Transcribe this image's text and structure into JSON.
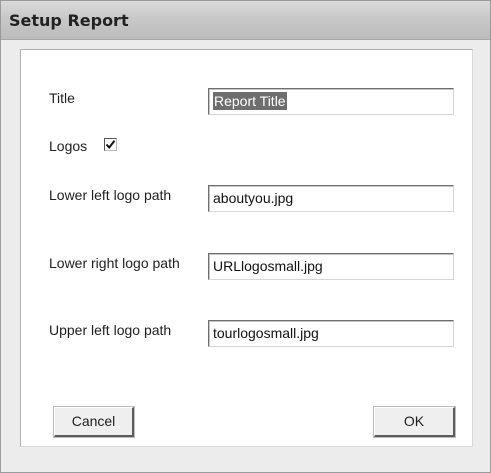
{
  "window": {
    "title": "Setup Report"
  },
  "form": {
    "title_label": "Title",
    "title_value": "Report Title",
    "logos_label": "Logos",
    "logos_checked": true,
    "lower_left_label": "Lower left logo path",
    "lower_left_value": "aboutyou.jpg",
    "lower_right_label": "Lower right logo path",
    "lower_right_value": "URLlogosmall.jpg",
    "upper_left_label": "Upper left logo path",
    "upper_left_value": "tourlogosmall.jpg"
  },
  "buttons": {
    "cancel_label": "Cancel",
    "ok_label": "OK"
  },
  "colors": {
    "titlebar": "#c8c8c8",
    "client_background": "#ffffff",
    "selection": "#6e6e6e"
  },
  "icons": {
    "logos_checkbox": "checkmark-icon"
  }
}
